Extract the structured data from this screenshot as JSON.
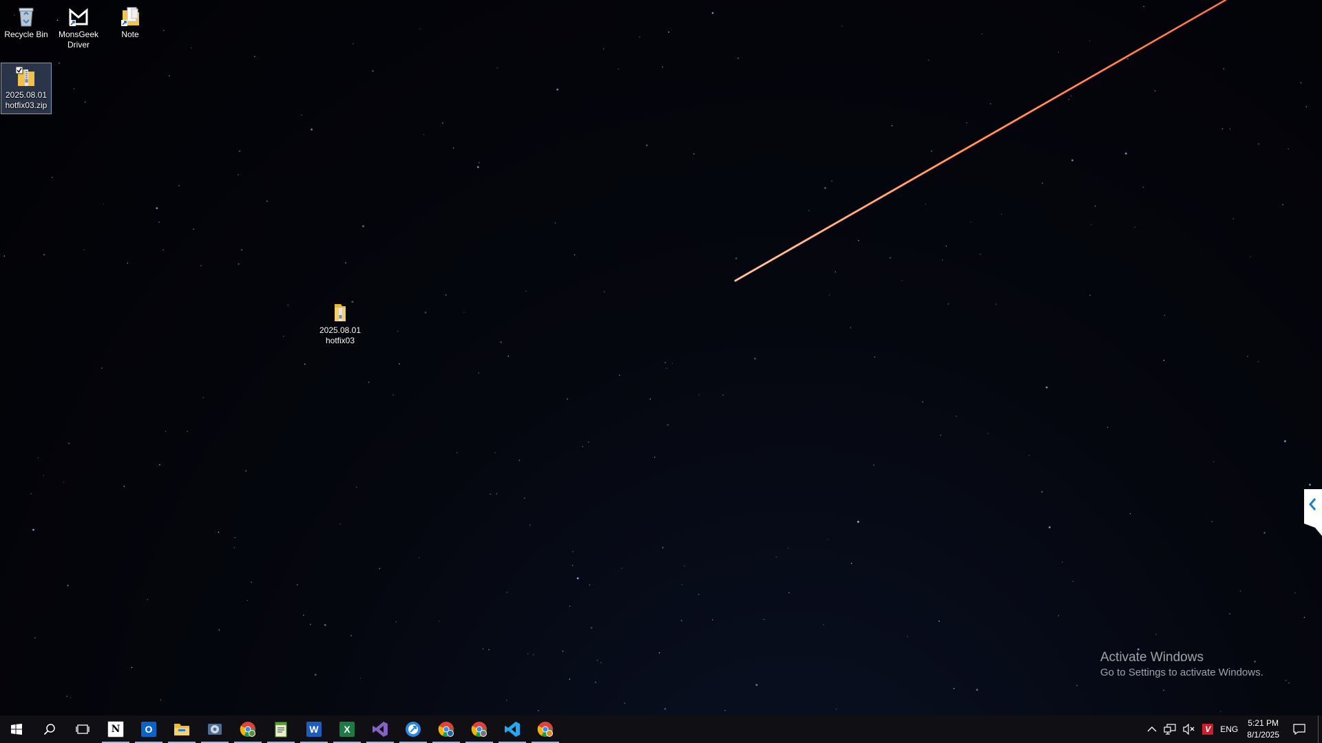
{
  "desktop": {
    "icons": [
      {
        "label": "Recycle Bin",
        "icon": "recycle-bin-icon"
      },
      {
        "label": "MonsGeek\nDriver",
        "icon": "monsgeek-driver-icon"
      },
      {
        "label": "Note",
        "icon": "note-shortcut-icon"
      },
      {
        "label": "2025.08.01\nhotfix03.zip",
        "icon": "zip-archive-icon",
        "selected": true
      },
      {
        "label": "2025.08.01\nhotfix03",
        "icon": "folder-icon"
      }
    ]
  },
  "watermark": {
    "title": "Activate Windows",
    "subtitle": "Go to Settings to activate Windows."
  },
  "taskbar": {
    "apps": [
      {
        "name": "notion-app",
        "icon": "notion-icon",
        "running": true
      },
      {
        "name": "outlook-app",
        "icon": "outlook-icon",
        "running": true
      },
      {
        "name": "file-explorer-app",
        "icon": "file-explorer-icon",
        "running": true
      },
      {
        "name": "app-4",
        "icon": "gear-app-icon",
        "running": true
      },
      {
        "name": "chrome-app-1",
        "icon": "chrome-icon",
        "running": true
      },
      {
        "name": "notepad-app",
        "icon": "notepad-icon",
        "running": true
      },
      {
        "name": "word-app",
        "icon": "word-icon",
        "running": true
      },
      {
        "name": "excel-app",
        "icon": "excel-icon",
        "running": true
      },
      {
        "name": "visual-studio-app",
        "icon": "visual-studio-icon",
        "running": true
      },
      {
        "name": "app-10",
        "icon": "blue-round-app-icon",
        "running": true
      },
      {
        "name": "chrome-app-2",
        "icon": "chrome-icon",
        "running": true
      },
      {
        "name": "chrome-app-3",
        "icon": "chrome-icon",
        "running": true
      },
      {
        "name": "vscode-app",
        "icon": "vscode-icon",
        "running": true
      },
      {
        "name": "chrome-app-4",
        "icon": "chrome-icon",
        "running": true
      }
    ],
    "tray": {
      "language": "ENG",
      "time": "5:21 PM",
      "date": "8/1/2025"
    }
  },
  "colors": {
    "taskbar_bg": "#101014",
    "running_indicator": "#9ab8e6",
    "meteor": "#ff7a3a"
  }
}
